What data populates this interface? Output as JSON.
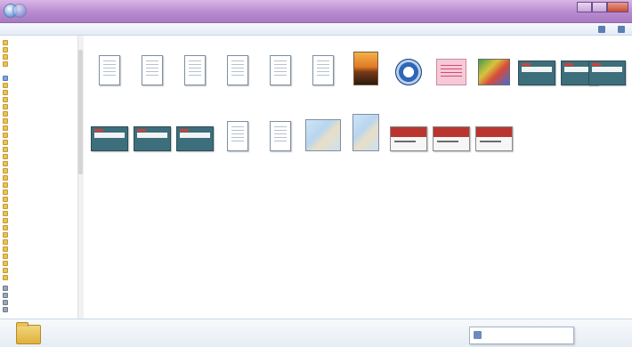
{
  "window": {
    "title": "",
    "controls": [
      "minimize",
      "maximize",
      "close"
    ]
  },
  "toolbar": {
    "items": [
      {
        "label": "",
        "icon": ""
      },
      {
        "label": "",
        "icon": ""
      },
      {
        "label": "",
        "icon": ""
      },
      {
        "label": "",
        "icon": ""
      },
      {
        "label": "",
        "icon": ""
      },
      {
        "label": "",
        "icon": ""
      },
      {
        "label": "",
        "icon": "view-options-icon"
      },
      {
        "label": "",
        "icon": "help-icon"
      }
    ]
  },
  "navigation": {
    "items": [
      {
        "label": "",
        "icon": "folder-icon"
      },
      {
        "label": "",
        "icon": "folder-icon"
      },
      {
        "label": "",
        "icon": "folder-icon"
      },
      {
        "label": "",
        "icon": "folder-icon"
      },
      {
        "label": "",
        "icon": "library-icon"
      },
      {
        "label": "",
        "icon": "folder-icon"
      },
      {
        "label": "",
        "icon": "folder-icon"
      },
      {
        "label": "",
        "icon": "folder-icon"
      },
      {
        "label": "",
        "icon": "folder-icon"
      },
      {
        "label": "",
        "icon": "folder-icon"
      },
      {
        "label": "",
        "icon": "folder-icon"
      },
      {
        "label": "",
        "icon": "folder-icon"
      },
      {
        "label": "",
        "icon": "folder-icon"
      },
      {
        "label": "",
        "icon": "folder-icon"
      },
      {
        "label": "",
        "icon": "folder-icon"
      },
      {
        "label": "",
        "icon": "folder-icon"
      },
      {
        "label": "",
        "icon": "folder-icon"
      },
      {
        "label": "",
        "icon": "folder-icon"
      },
      {
        "label": "",
        "icon": "folder-icon"
      },
      {
        "label": "",
        "icon": "folder-icon"
      },
      {
        "label": "",
        "icon": "folder-icon"
      },
      {
        "label": "",
        "icon": "folder-icon"
      },
      {
        "label": "",
        "icon": "folder-icon"
      },
      {
        "label": "",
        "icon": "folder-icon"
      },
      {
        "label": "",
        "icon": "folder-icon"
      },
      {
        "label": "",
        "icon": "folder-icon"
      },
      {
        "label": "",
        "icon": "folder-icon"
      },
      {
        "label": "",
        "icon": "folder-icon"
      },
      {
        "label": "",
        "icon": "folder-icon"
      },
      {
        "label": "",
        "icon": "folder-icon"
      },
      {
        "label": "",
        "icon": "folder-icon"
      },
      {
        "label": "",
        "icon": "folder-icon"
      },
      {
        "label": "",
        "icon": "folder-icon"
      },
      {
        "label": "",
        "icon": "drive-icon"
      },
      {
        "label": "",
        "icon": "drive-icon"
      },
      {
        "label": "",
        "icon": "drive-icon"
      },
      {
        "label": "",
        "icon": "drive-icon"
      }
    ]
  },
  "files": [
    {
      "name": "",
      "type": "document"
    },
    {
      "name": "",
      "type": "document"
    },
    {
      "name": "",
      "type": "document"
    },
    {
      "name": "",
      "type": "document"
    },
    {
      "name": "",
      "type": "document"
    },
    {
      "name": "",
      "type": "document"
    },
    {
      "name": "",
      "type": "photo-sunset"
    },
    {
      "name": "",
      "type": "logo"
    },
    {
      "name": "",
      "type": "pink-doc"
    },
    {
      "name": "",
      "type": "colorful-image"
    },
    {
      "name": "",
      "type": "slide"
    },
    {
      "name": "",
      "type": "slide"
    },
    {
      "name": "",
      "type": "slide"
    },
    {
      "name": "",
      "type": "slide"
    },
    {
      "name": "",
      "type": "slide"
    },
    {
      "name": "",
      "type": "slide"
    },
    {
      "name": "",
      "type": "document"
    },
    {
      "name": "",
      "type": "document"
    },
    {
      "name": "",
      "type": "map"
    },
    {
      "name": "",
      "type": "map"
    },
    {
      "name": "",
      "type": "slide-red"
    },
    {
      "name": "",
      "type": "slide-red"
    },
    {
      "name": "",
      "type": "slide-red"
    }
  ],
  "status": {
    "text": "",
    "notification": ""
  }
}
